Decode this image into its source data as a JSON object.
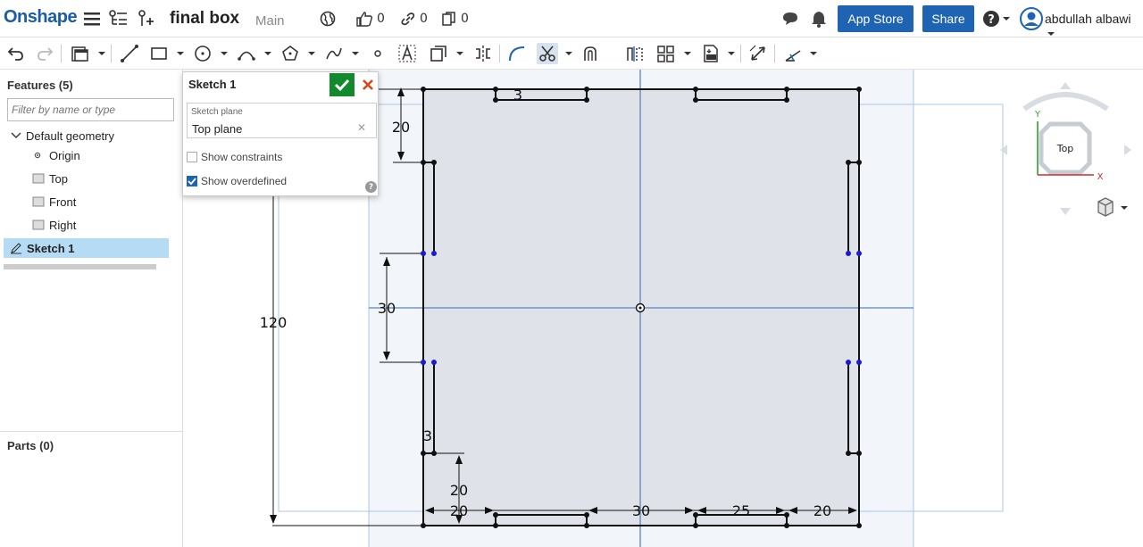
{
  "header": {
    "logo": "Onshape",
    "doc_title": "final box",
    "branch": "Main",
    "likes": "0",
    "links": "0",
    "copies": "0",
    "app_store_label": "App Store",
    "share_label": "Share",
    "user_name": "abdullah albawi",
    "accent": "#1f63b3"
  },
  "features_panel": {
    "heading": "Features (5)",
    "filter_placeholder": "Filter by name or type",
    "tree": [
      {
        "label": "Default geometry",
        "icon": "chevron-down-icon"
      },
      {
        "label": "Origin",
        "icon": "origin-point-icon"
      },
      {
        "label": "Top",
        "icon": "plane-icon"
      },
      {
        "label": "Front",
        "icon": "plane-icon"
      },
      {
        "label": "Right",
        "icon": "plane-icon"
      },
      {
        "label": "Sketch 1",
        "icon": "sketch-icon",
        "selected": true
      }
    ],
    "parts_heading": "Parts (0)"
  },
  "sketch_dialog": {
    "title": "Sketch 1",
    "plane_label": "Sketch plane",
    "plane_value": "Top plane",
    "show_constraints": {
      "label": "Show constraints",
      "checked": false
    },
    "show_overdefined": {
      "label": "Show overdefined",
      "checked": true
    },
    "help": "?",
    "ok_color": "#12892d",
    "cancel_color": "#d9461b"
  },
  "dimensions": {
    "top_slot_depth": "3",
    "left_top_offset": "20",
    "overall_height": "120",
    "left_tab_length": "30",
    "bottom_slot_depth": "3",
    "bottom_left_offset": "20",
    "bottom_seg1": "20",
    "bottom_seg2": "30",
    "bottom_seg3": "25",
    "bottom_seg4": "20"
  },
  "view_cube": {
    "face": "Top",
    "axis_y": "Y",
    "axis_x": "X"
  }
}
